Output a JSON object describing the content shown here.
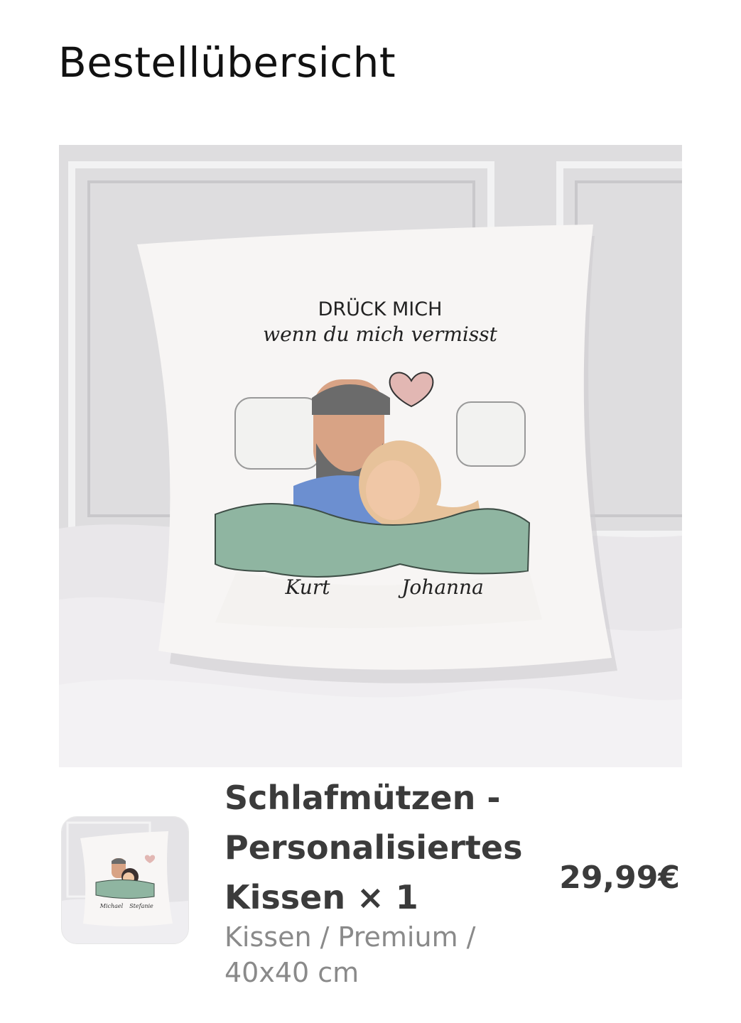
{
  "header": {
    "title": "Bestellübersicht"
  },
  "product_image": {
    "print_headline": "DRÜCK MICH",
    "print_subline": "wenn du mich vermisst",
    "name_left": "Kurt",
    "name_right": "Johanna"
  },
  "thumbnail": {
    "name_left": "Michael",
    "name_right": "Stefanie"
  },
  "order_item": {
    "title": "Schlafmützen - Personalisiertes Kissen × 1",
    "variant": "Kissen / Premium / 40x40 cm",
    "price": "29,99€"
  },
  "colors": {
    "blanket": "#8fb5a1",
    "heart": "#e2b7b3",
    "text_dark": "#3b3b3b",
    "text_muted": "#8a8a8a"
  }
}
